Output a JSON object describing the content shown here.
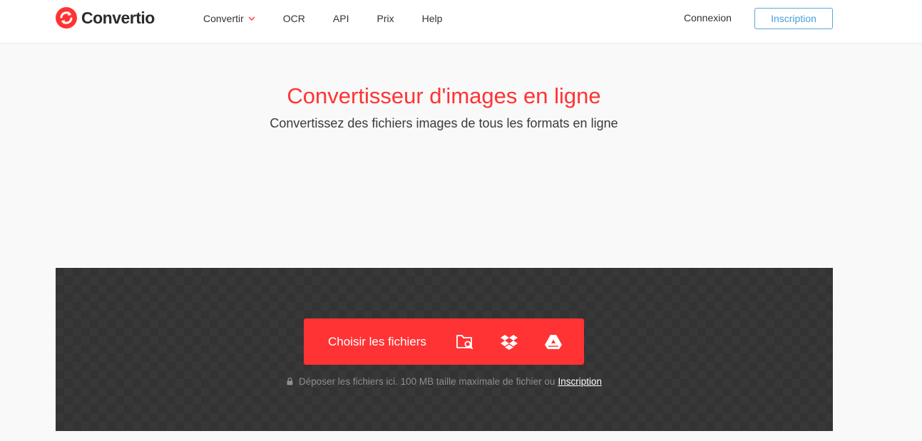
{
  "brand": {
    "name": "Convertio",
    "color": "#ff3333"
  },
  "nav": {
    "items": [
      {
        "label": "Convertir",
        "has_dropdown": true
      },
      {
        "label": "OCR"
      },
      {
        "label": "API"
      },
      {
        "label": "Prix"
      },
      {
        "label": "Help"
      }
    ],
    "login_label": "Connexion",
    "signup_label": "Inscription"
  },
  "hero": {
    "title": "Convertisseur d'images en ligne",
    "subtitle": "Convertissez des fichiers images de tous les formats en ligne"
  },
  "upload": {
    "choose_label": "Choisir les fichiers",
    "sources": [
      "folder-search-icon",
      "dropbox-icon",
      "google-drive-icon"
    ],
    "drop_note": "Déposer les fichiers ici. 100 MB taille maximale de fichier ou",
    "drop_link": "Inscription"
  }
}
